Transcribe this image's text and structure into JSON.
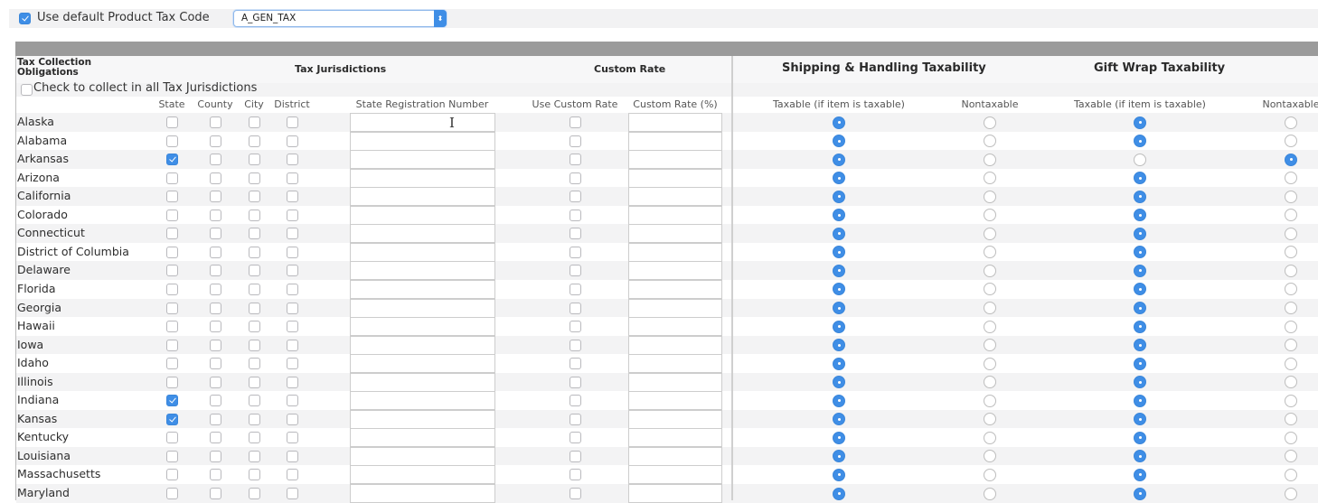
{
  "top": {
    "use_default_label": "Use default Product Tax Code",
    "use_default_checked": true,
    "product_tax_code": "A_GEN_TAX",
    "select_arrow": "⬍"
  },
  "headers": {
    "tax_collection_obligations": "Tax Collection Obligations",
    "tax_jurisdictions": "Tax Jurisdictions",
    "custom_rate": "Custom Rate",
    "shipping_handling": "Shipping & Handling Taxability",
    "gift_wrap": "Gift Wrap Taxability",
    "check_all_label": "Check to collect in all Tax Jurisdictions",
    "check_all_checked": false,
    "columns": {
      "state": "State",
      "county": "County",
      "city": "City",
      "district": "District",
      "state_registration_number": "State Registration Number",
      "use_custom_rate": "Use Custom Rate",
      "custom_rate_pct": "Custom Rate (%)",
      "sh_taxable": "Taxable (if item is taxable)",
      "sh_nontaxable": "Nontaxable",
      "gw_taxable": "Taxable (if item is taxable)",
      "gw_nontaxable": "Nontaxable"
    }
  },
  "rows": [
    {
      "state": "Alaska",
      "collect_state": false,
      "county": false,
      "city": false,
      "district": false,
      "registration": "",
      "use_custom": false,
      "custom_rate": "",
      "shipping": "taxable",
      "giftwrap": "taxable"
    },
    {
      "state": "Alabama",
      "collect_state": false,
      "county": false,
      "city": false,
      "district": false,
      "registration": "",
      "use_custom": false,
      "custom_rate": "",
      "shipping": "taxable",
      "giftwrap": "taxable"
    },
    {
      "state": "Arkansas",
      "collect_state": true,
      "county": false,
      "city": false,
      "district": false,
      "registration": "",
      "use_custom": false,
      "custom_rate": "",
      "shipping": "taxable",
      "giftwrap": "nontaxable"
    },
    {
      "state": "Arizona",
      "collect_state": false,
      "county": false,
      "city": false,
      "district": false,
      "registration": "",
      "use_custom": false,
      "custom_rate": "",
      "shipping": "taxable",
      "giftwrap": "taxable"
    },
    {
      "state": "California",
      "collect_state": false,
      "county": false,
      "city": false,
      "district": false,
      "registration": "",
      "use_custom": false,
      "custom_rate": "",
      "shipping": "taxable",
      "giftwrap": "taxable"
    },
    {
      "state": "Colorado",
      "collect_state": false,
      "county": false,
      "city": false,
      "district": false,
      "registration": "",
      "use_custom": false,
      "custom_rate": "",
      "shipping": "taxable",
      "giftwrap": "taxable"
    },
    {
      "state": "Connecticut",
      "collect_state": false,
      "county": false,
      "city": false,
      "district": false,
      "registration": "",
      "use_custom": false,
      "custom_rate": "",
      "shipping": "taxable",
      "giftwrap": "taxable"
    },
    {
      "state": "District of Columbia",
      "collect_state": false,
      "county": false,
      "city": false,
      "district": false,
      "registration": "",
      "use_custom": false,
      "custom_rate": "",
      "shipping": "taxable",
      "giftwrap": "taxable"
    },
    {
      "state": "Delaware",
      "collect_state": false,
      "county": false,
      "city": false,
      "district": false,
      "registration": "",
      "use_custom": false,
      "custom_rate": "",
      "shipping": "taxable",
      "giftwrap": "taxable"
    },
    {
      "state": "Florida",
      "collect_state": false,
      "county": false,
      "city": false,
      "district": false,
      "registration": "",
      "use_custom": false,
      "custom_rate": "",
      "shipping": "taxable",
      "giftwrap": "taxable"
    },
    {
      "state": "Georgia",
      "collect_state": false,
      "county": false,
      "city": false,
      "district": false,
      "registration": "",
      "use_custom": false,
      "custom_rate": "",
      "shipping": "taxable",
      "giftwrap": "taxable"
    },
    {
      "state": "Hawaii",
      "collect_state": false,
      "county": false,
      "city": false,
      "district": false,
      "registration": "",
      "use_custom": false,
      "custom_rate": "",
      "shipping": "taxable",
      "giftwrap": "taxable"
    },
    {
      "state": "Iowa",
      "collect_state": false,
      "county": false,
      "city": false,
      "district": false,
      "registration": "",
      "use_custom": false,
      "custom_rate": "",
      "shipping": "taxable",
      "giftwrap": "taxable"
    },
    {
      "state": "Idaho",
      "collect_state": false,
      "county": false,
      "city": false,
      "district": false,
      "registration": "",
      "use_custom": false,
      "custom_rate": "",
      "shipping": "taxable",
      "giftwrap": "taxable"
    },
    {
      "state": "Illinois",
      "collect_state": false,
      "county": false,
      "city": false,
      "district": false,
      "registration": "",
      "use_custom": false,
      "custom_rate": "",
      "shipping": "taxable",
      "giftwrap": "taxable"
    },
    {
      "state": "Indiana",
      "collect_state": true,
      "county": false,
      "city": false,
      "district": false,
      "registration": "",
      "use_custom": false,
      "custom_rate": "",
      "shipping": "taxable",
      "giftwrap": "taxable"
    },
    {
      "state": "Kansas",
      "collect_state": true,
      "county": false,
      "city": false,
      "district": false,
      "registration": "",
      "use_custom": false,
      "custom_rate": "",
      "shipping": "taxable",
      "giftwrap": "taxable"
    },
    {
      "state": "Kentucky",
      "collect_state": false,
      "county": false,
      "city": false,
      "district": false,
      "registration": "",
      "use_custom": false,
      "custom_rate": "",
      "shipping": "taxable",
      "giftwrap": "taxable"
    },
    {
      "state": "Louisiana",
      "collect_state": false,
      "county": false,
      "city": false,
      "district": false,
      "registration": "",
      "use_custom": false,
      "custom_rate": "",
      "shipping": "taxable",
      "giftwrap": "taxable"
    },
    {
      "state": "Massachusetts",
      "collect_state": false,
      "county": false,
      "city": false,
      "district": false,
      "registration": "",
      "use_custom": false,
      "custom_rate": "",
      "shipping": "taxable",
      "giftwrap": "taxable"
    },
    {
      "state": "Maryland",
      "collect_state": false,
      "county": false,
      "city": false,
      "district": false,
      "registration": "",
      "use_custom": false,
      "custom_rate": "",
      "shipping": "taxable",
      "giftwrap": "taxable"
    }
  ],
  "cursor": "I"
}
